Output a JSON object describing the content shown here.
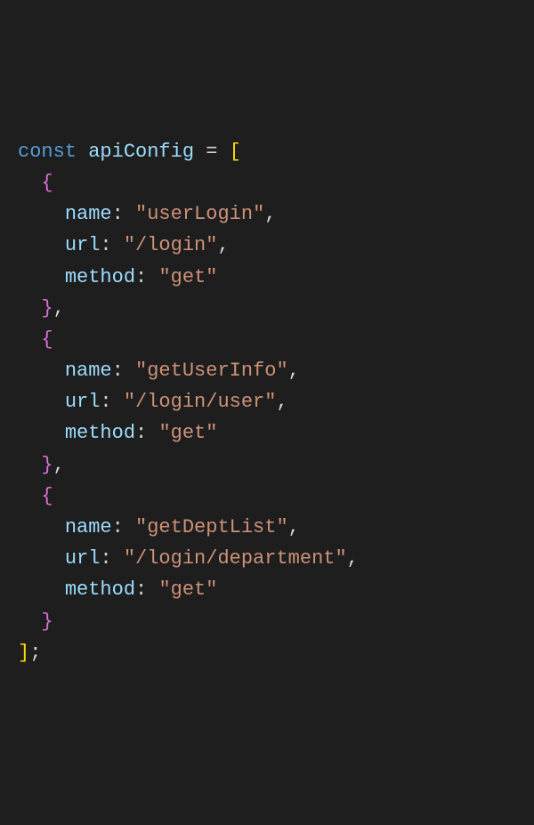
{
  "code": {
    "keyword_const": "const",
    "var_name": "apiConfig",
    "op_assign": "=",
    "bracket_open_sq": "[",
    "bracket_close_sq": "]",
    "semicolon": ";",
    "brace_open": "{",
    "brace_close": "}",
    "comma": ",",
    "colon": ":",
    "quote": "\"",
    "prop_name": "name",
    "prop_url": "url",
    "prop_method": "method",
    "items": [
      {
        "name": "userLogin",
        "url": "/login",
        "method": "get"
      },
      {
        "name": "getUserInfo",
        "url": "/login/user",
        "method": "get"
      },
      {
        "name": "getDeptList",
        "url": "/login/department",
        "method": "get"
      }
    ]
  }
}
